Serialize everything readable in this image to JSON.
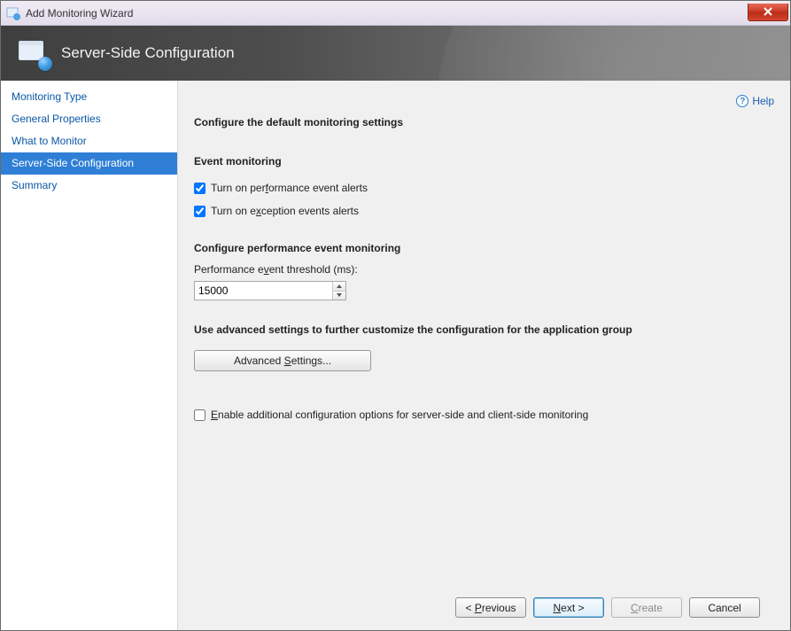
{
  "window": {
    "title": "Add Monitoring Wizard"
  },
  "banner": {
    "title": "Server-Side Configuration"
  },
  "sidebar": {
    "items": [
      {
        "label": "Monitoring Type",
        "active": false
      },
      {
        "label": "General Properties",
        "active": false
      },
      {
        "label": "What to Monitor",
        "active": false
      },
      {
        "label": "Server-Side Configuration",
        "active": true
      },
      {
        "label": "Summary",
        "active": false
      }
    ]
  },
  "help": {
    "label": "Help"
  },
  "content": {
    "heading": "Configure the default monitoring settings",
    "event_monitoring": {
      "title": "Event monitoring",
      "perf_alerts": {
        "label_pre": "Turn on per",
        "label_u": "f",
        "label_post": "ormance event alerts",
        "checked": true
      },
      "exc_alerts": {
        "label_pre": "Turn on e",
        "label_u": "x",
        "label_post": "ception events alerts",
        "checked": true
      }
    },
    "perf_config": {
      "title": "Configure performance event monitoring",
      "threshold_label_pre": "Performance e",
      "threshold_label_u": "v",
      "threshold_label_post": "ent threshold (ms):",
      "threshold_value": "15000"
    },
    "advanced": {
      "title": "Use advanced settings to further customize the configuration for the application group",
      "button_pre": "Advanced ",
      "button_u": "S",
      "button_post": "ettings..."
    },
    "additional": {
      "label_pre": "",
      "label_u": "E",
      "label_post": "nable additional configuration options for server-side and client-side monitoring",
      "checked": false
    }
  },
  "footer": {
    "previous_pre": "< ",
    "previous_u": "P",
    "previous_post": "revious",
    "next_pre": "",
    "next_u": "N",
    "next_post": "ext >",
    "create_pre": "",
    "create_u": "C",
    "create_post": "reate",
    "cancel": "Cancel"
  }
}
